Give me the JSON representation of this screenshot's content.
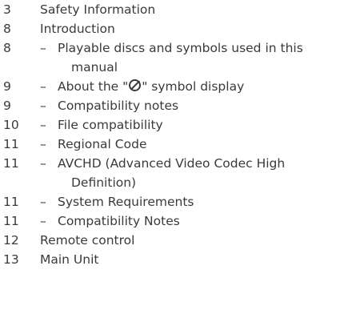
{
  "entries": [
    {
      "page": "3",
      "title": "Safety Information"
    },
    {
      "page": "8",
      "title": "Introduction"
    },
    {
      "page": "8",
      "dash": "–",
      "title": "Playable discs and symbols used in this",
      "title_cont": "manual"
    },
    {
      "page": "9",
      "dash": "–",
      "title_before": "About the \"",
      "symbol": "prohibited-circle-icon",
      "title_after": "\" symbol display"
    },
    {
      "page": "9",
      "dash": "–",
      "title": "Compatibility notes"
    },
    {
      "page": "10",
      "dash": "–",
      "title": "File compatibility"
    },
    {
      "page": "11",
      "dash": "–",
      "title": "Regional Code"
    },
    {
      "page": "11",
      "dash": "–",
      "title": "AVCHD (Advanced Video Codec High",
      "title_cont": "Definition)"
    },
    {
      "page": "11",
      "dash": "–",
      "title": "System Requirements"
    },
    {
      "page": "11",
      "dash": "–",
      "title": "Compatibility Notes"
    },
    {
      "page": "12",
      "title": "Remote control"
    },
    {
      "page": "13",
      "title": "Main Unit"
    }
  ]
}
